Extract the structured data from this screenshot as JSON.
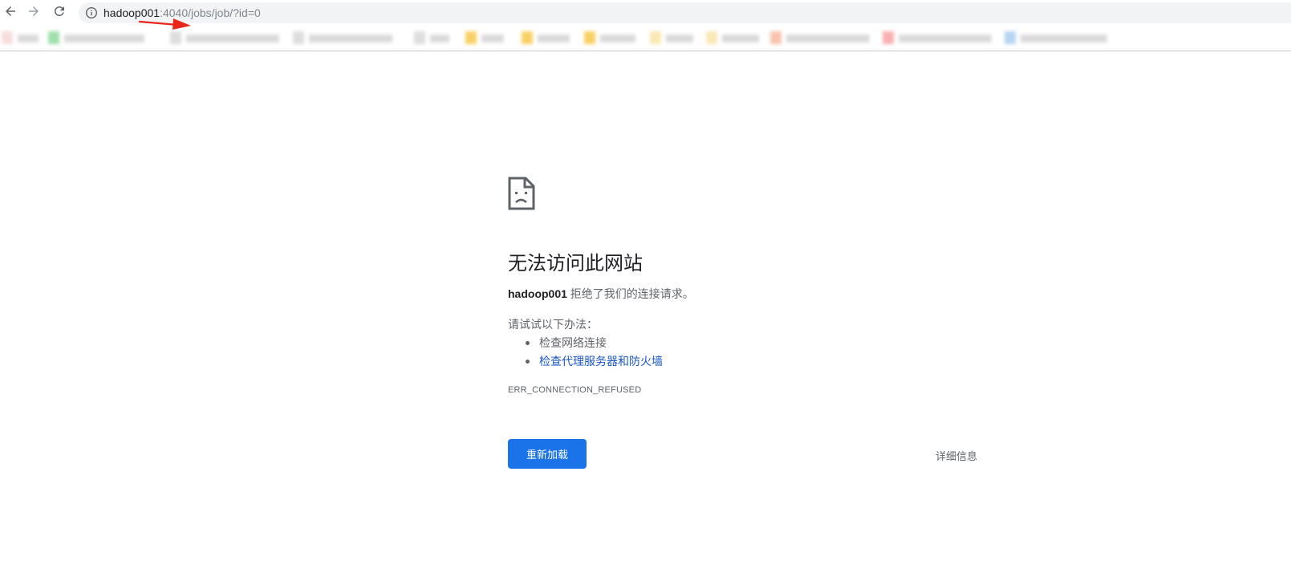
{
  "toolbar": {
    "back_icon": "arrow-left-icon",
    "forward_icon": "arrow-right-icon",
    "reload_icon": "reload-icon",
    "info_icon": "info-icon",
    "url_host": "hadoop001",
    "url_path": ":4040/jobs/job/?id=0"
  },
  "bookmarks": {
    "icon_colors": [
      "#f8d7d7",
      "#8fd99a",
      "#d8d8d8",
      "#d8d8d8",
      "#d8d8d8",
      "#f7c94b",
      "#f7c94b",
      "#f7c94b",
      "#f9e4a8",
      "#f9e4a8",
      "#f7b8a0",
      "#f7a3a3",
      "#a8cdf0",
      "#a8ddf0"
    ]
  },
  "error": {
    "icon": "sad-page-icon",
    "headline": "无法访问此网站",
    "host": "hadoop001",
    "description": " 拒绝了我们的连接请求。",
    "suggestions_title": "请试试以下办法：",
    "suggestions": [
      "检查网络连接",
      "检查代理服务器和防火墙"
    ],
    "error_code": "ERR_CONNECTION_REFUSED",
    "reload_label": "重新加载",
    "details_label": "详细信息"
  },
  "colors": {
    "accent": "#1a73e8",
    "link": "#1a56c6",
    "annotation_arrow": "#e8261c"
  }
}
